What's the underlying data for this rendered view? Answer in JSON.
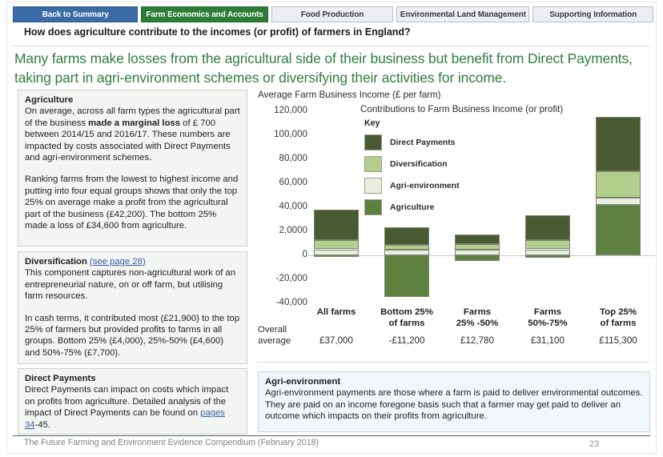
{
  "tabs": [
    {
      "label": "Back to Summary",
      "style": "blue"
    },
    {
      "label": "Farm Economics and Accounts",
      "style": "green"
    },
    {
      "label": "Food Production",
      "style": "grey"
    },
    {
      "label": "Environmental Land Management",
      "style": "grey"
    },
    {
      "label": "Supporting Information",
      "style": "grey"
    }
  ],
  "question": "How does agriculture contribute to the incomes (or profit) of farmers in England?",
  "headline": "Many farms make losses from the agricultural side of their business but benefit from Direct Payments, taking part in agri-environment schemes or diversifying their activities for income.",
  "boxes": {
    "agriculture": {
      "title": "Agriculture",
      "p1_a": "On average, across all farm types the agricultural part of the business ",
      "p1_bold": "made a marginal loss",
      "p1_b": " of £ 700 between 2014/15 and 2016/17. These numbers are impacted by costs associated with Direct Payments and agri-environment schemes.",
      "p2": "Ranking farms from the lowest to highest income and putting into four equal groups shows that only the top 25% on average make a profit from the agricultural part of the business (£42,200). The bottom 25% made a loss of £34,600 from agriculture."
    },
    "diversification": {
      "title": "Diversification ",
      "link": "(see page 28)",
      "p1": "This component captures non-agricultural work of an entrepreneurial nature, on or off farm, but utilising farm resources.",
      "p2": "In cash terms, it contributed most (£21,900) to the top 25% of farmers but provided profits to farms in all groups. Bottom 25% (£4,000), 25%-50% (£4,600) and 50%-75% (£7,700)."
    },
    "direct_payments": {
      "title": "Direct Payments",
      "p1_a": "Direct Payments can impact on costs which impact on profits from agriculture. Detailed analysis of the impact of Direct Payments can be found on ",
      "link": "pages 34",
      "p1_b": "-45."
    },
    "agri_environment": {
      "title": "Agri-environment",
      "p1": "Agri-environment payments are those where a farm is paid to deliver environmental outcomes. They are paid on an income foregone basis such that a farmer may get paid to deliver an outcome which impacts on their profits from agriculture."
    }
  },
  "footer": {
    "text": "The Future Farming and Environment Evidence Compendium (February 2018)",
    "page": "23"
  },
  "chart_data": {
    "type": "bar",
    "stacked": true,
    "title": "Contributions to Farm Business Income (or profit)",
    "ylabel": "Average Farm Business Income (£ per farm)",
    "xlabel": "",
    "legend_title": "Key",
    "legend_position": "inside-top-left",
    "grid": false,
    "ylim": [
      -40000,
      120000
    ],
    "ytick_labels": [
      "120,000",
      "100,000",
      "80,000",
      "60,000",
      "40,000",
      "2,0000",
      "0",
      "-20,000",
      "-40,000"
    ],
    "ytick_values": [
      120000,
      100000,
      80000,
      60000,
      40000,
      20000,
      0,
      -20000,
      -40000
    ],
    "categories": [
      "All farms",
      "Bottom 25% of farms",
      "Farms 25% -50%",
      "Farms 50%-75%",
      "Top 25% of farms"
    ],
    "series": [
      {
        "name": "Agriculture",
        "color": "#5E8140",
        "values": [
          -700,
          -34600,
          -4500,
          -2000,
          42200
        ]
      },
      {
        "name": "Agri-environment",
        "color": "#E9EFE0",
        "values": [
          5000,
          4400,
          4600,
          5000,
          5600
        ]
      },
      {
        "name": "Diversification",
        "color": "#B4CE8E",
        "values": [
          7800,
          4000,
          4600,
          7700,
          21900
        ]
      },
      {
        "name": "Direct Payments",
        "color": "#4A5A32",
        "values": [
          24900,
          15000,
          8080,
          20400,
          45600
        ]
      }
    ],
    "overall_average_label": "Overall average",
    "overall_average_values": [
      "£37,000",
      "-£11,200",
      "£12,780",
      "£31,100",
      "£115,300"
    ]
  }
}
